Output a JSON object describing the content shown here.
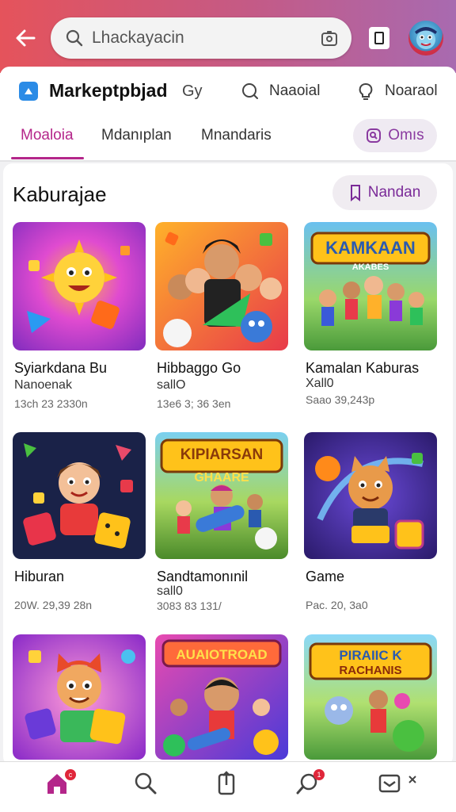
{
  "search": {
    "value": "Lhackayacin"
  },
  "header": {
    "brand": "Markeptpbjad",
    "brand_suffix": "Gy",
    "nav": [
      {
        "label": "Naaoial"
      },
      {
        "label": "Noaraol"
      }
    ],
    "tabs": [
      {
        "label": "Moaloia"
      },
      {
        "label": "Mdanıplan"
      },
      {
        "label": "Mnandaris"
      }
    ],
    "pill_label": "Omıs"
  },
  "section": {
    "title": "Kaburajae",
    "button_label": "Nandan"
  },
  "apps": [
    {
      "title": "Syiarkdana Bu",
      "subtitle": "Nanoenak",
      "meta": "13ch 23 2330n"
    },
    {
      "title": "Hibbaggo Go",
      "subtitle": "sallO",
      "meta": "13e6 3; 36 3en"
    },
    {
      "title": "Kamalan Kaburas",
      "subtitle": "Xall0",
      "meta": "Saao 39,243p"
    },
    {
      "title": "Hiburan",
      "subtitle": "",
      "meta": "20W. 29,39 28n"
    },
    {
      "title": "Sandtamonınil",
      "subtitle": "sall0",
      "meta": "3083 83 131/"
    },
    {
      "title": "Game",
      "subtitle": "",
      "meta": "Pac. 20, 3a0"
    },
    {
      "title": "",
      "subtitle": "",
      "meta": ""
    },
    {
      "title": "",
      "subtitle": "",
      "meta": ""
    },
    {
      "title": "",
      "subtitle": "",
      "meta": ""
    }
  ],
  "thumb_banners": {
    "kamkaan": "KAMKAAN",
    "kamkaan_sub": "AKABES",
    "kipiarsan": "KIPIARSAN",
    "kipiarsan_sub": "GHAARE",
    "aualorbad": "AUAIOTROAD",
    "piraric": "PIRAIIC K",
    "piraric_sub": "RACHANIS"
  },
  "bottom_nav": {
    "badges": [
      "c",
      "1"
    ]
  },
  "colors": {
    "accent": "#b4268a",
    "topbar_start": "#e5535b",
    "topbar_end": "#a86ab0",
    "badge": "#e0263a"
  },
  "icons": [
    "back-arrow-icon",
    "search-icon",
    "camera-icon",
    "bookmark-icon",
    "avatar",
    "search-icon",
    "lightbulb-icon",
    "home-icon",
    "search-icon",
    "upload-icon",
    "chat-icon",
    "inbox-icon"
  ]
}
